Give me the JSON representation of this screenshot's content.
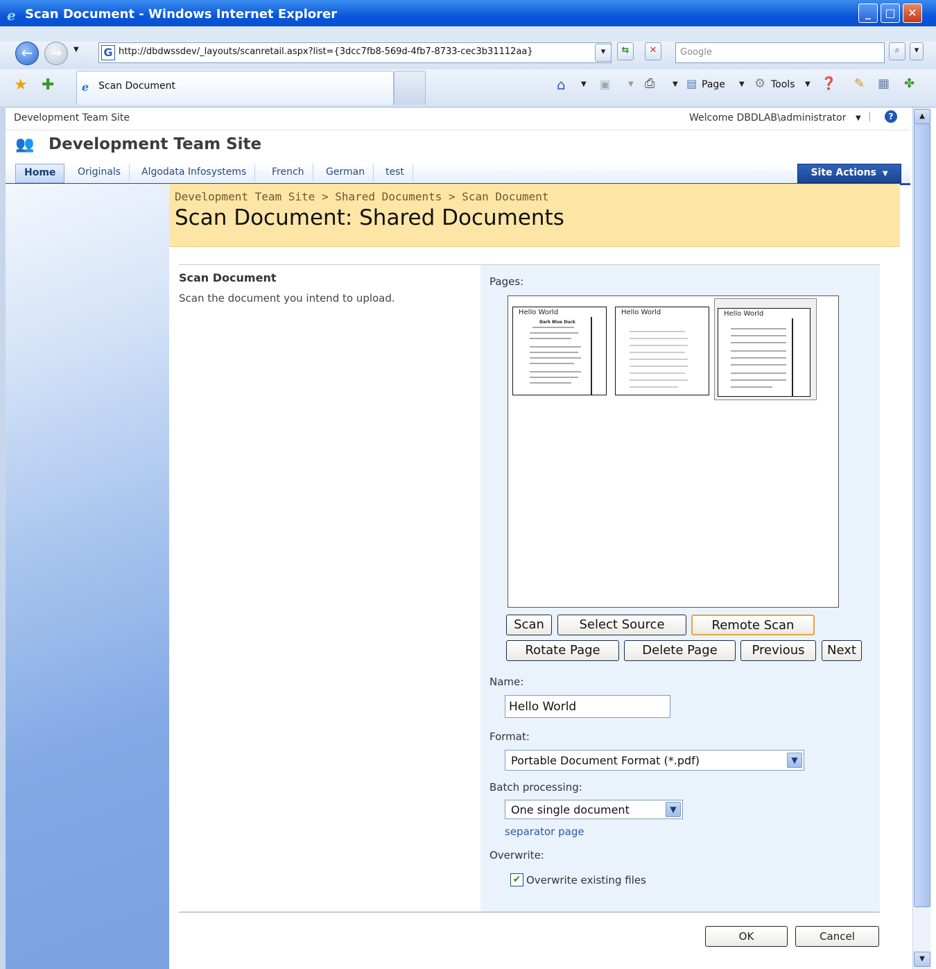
{
  "window": {
    "title": "Scan Document - Windows Internet Explorer"
  },
  "browser": {
    "url": "http://dbdwssdev/_layouts/scanretail.aspx?list={3dcc7fb8-569d-4fb7-8733-cec3b31112aa}",
    "search_placeholder": "Google",
    "tab_title": "Scan Document",
    "commands": {
      "page": "Page",
      "tools": "Tools"
    }
  },
  "sharepoint": {
    "top_site": "Development Team Site",
    "welcome": "Welcome DBDLAB\\administrator",
    "site_title": "Development Team Site",
    "nav_tabs": [
      "Home",
      "Originals",
      "Algodata Infosystems",
      "French",
      "German",
      "test"
    ],
    "site_actions": "Site Actions",
    "breadcrumb": [
      "Development Team Site",
      "Shared Documents",
      "Scan Document"
    ],
    "breadcrumb_sep": ">",
    "page_title": "Scan Document: Shared Documents"
  },
  "form": {
    "section_title": "Scan Document",
    "section_desc": "Scan the document you intend to upload.",
    "pages_label": "Pages:",
    "thumb_header": "Hello World",
    "thumb_doc_title": "Dark Blue Duck",
    "buttons": {
      "scan": "Scan",
      "select_source": "Select Source",
      "remote_scan": "Remote Scan",
      "rotate_page": "Rotate Page",
      "delete_page": "Delete Page",
      "previous": "Previous",
      "next": "Next"
    },
    "name_label": "Name:",
    "name_value": "Hello World",
    "format_label": "Format:",
    "format_value": "Portable Document Format (*.pdf)",
    "batch_label": "Batch processing:",
    "batch_value": "One single document",
    "separator_link": "separator page",
    "overwrite_label": "Overwrite:",
    "overwrite_checkbox": "Overwrite existing files",
    "overwrite_checked": true,
    "ok": "OK",
    "cancel": "Cancel"
  },
  "colors": {
    "title_bar": "#0a55d8",
    "title_area": "#fde5a6",
    "form_panel": "#eaf2fc",
    "site_actions": "#1a4594"
  }
}
